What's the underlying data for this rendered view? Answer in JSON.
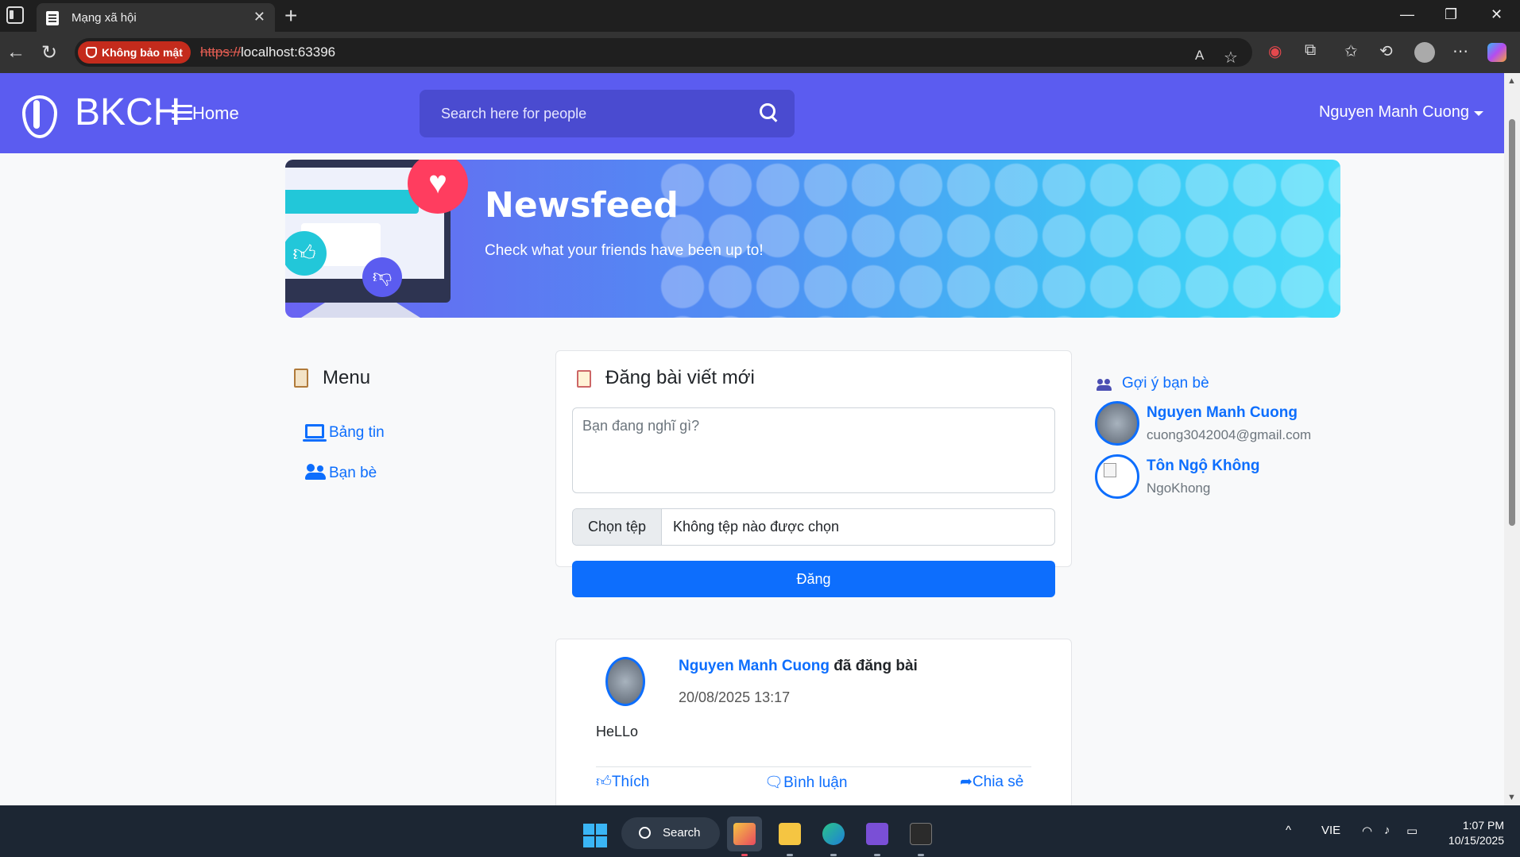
{
  "browser": {
    "tab_title": "Mạng xã hội",
    "security_label": "Không bảo mật",
    "url_protocol": "https://",
    "url_rest": "localhost:63396"
  },
  "navbar": {
    "brand": "BKCH",
    "home": "Home",
    "search_placeholder": "Search here for people",
    "user_name": "Nguyen Manh Cuong"
  },
  "banner": {
    "title": "Newsfeed",
    "subtitle": "Check what your friends have been up to!"
  },
  "menu": {
    "title": "Menu",
    "items": [
      {
        "label": "Bảng tin",
        "icon": "monitor-icon"
      },
      {
        "label": "Bạn bè",
        "icon": "users-icon"
      }
    ]
  },
  "composer": {
    "title": "Đăng bài viết mới",
    "placeholder": "Bạn đang nghĩ gì?",
    "file_button": "Chọn tệp",
    "file_status": "Không tệp nào được chọn",
    "submit": "Đăng"
  },
  "post": {
    "author": "Nguyen Manh Cuong",
    "action": " đã đăng bài",
    "time": "20/08/2025 13:17",
    "content": "HeLLo",
    "like": "Thích",
    "comment": "Bình luận",
    "share": "Chia sẻ"
  },
  "suggestions": {
    "title": "Gợi ý bạn bè",
    "friends": [
      {
        "name": "Nguyen Manh Cuong",
        "sub": "cuong3042004@gmail.com"
      },
      {
        "name": "Tôn Ngộ Không",
        "sub": "NgoKhong"
      }
    ]
  },
  "taskbar": {
    "search": "Search",
    "language": "VIE",
    "time": "1:07 PM",
    "date": "10/15/2025"
  },
  "colors": {
    "navbar": "#5b5cf0",
    "primary": "#0d6efd",
    "security": "#c42b1c"
  }
}
